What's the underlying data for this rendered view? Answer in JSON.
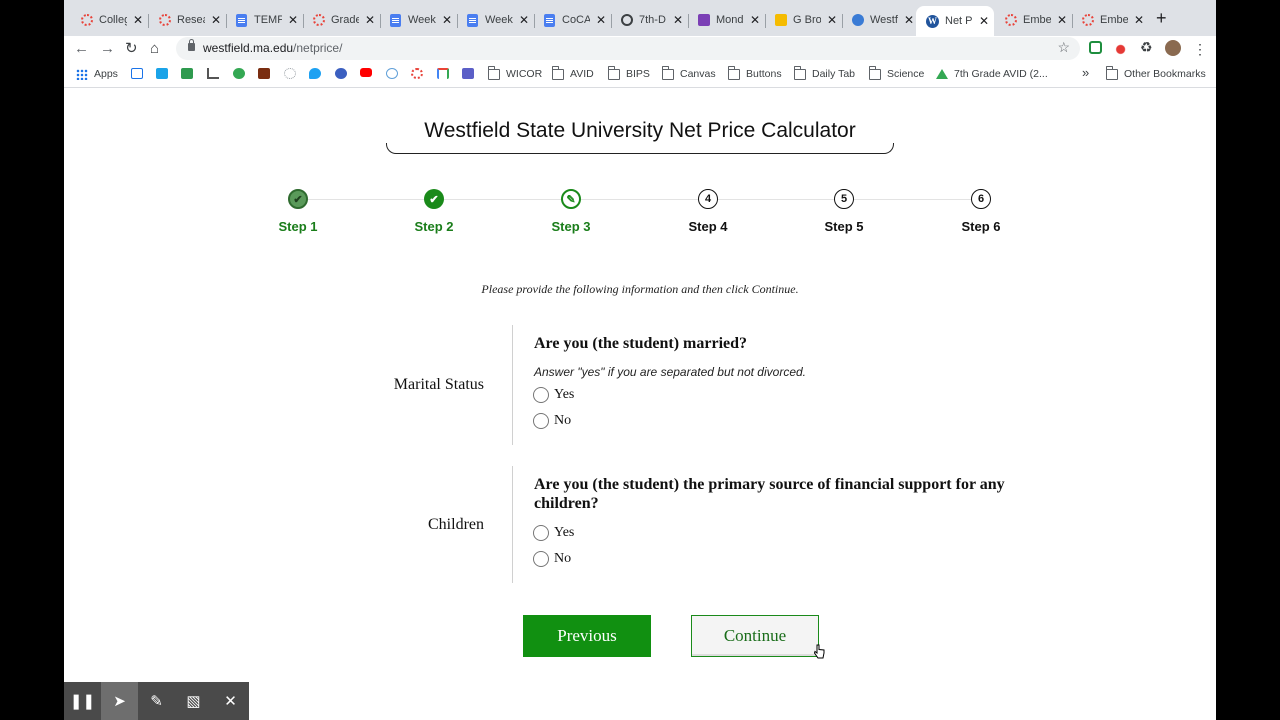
{
  "tabs": [
    {
      "title": "College",
      "favicon": "red-dotted-circle-icon"
    },
    {
      "title": "Research",
      "favicon": "red-dotted-circle-icon"
    },
    {
      "title": "TEMP",
      "favicon": "google-docs-icon"
    },
    {
      "title": "Grade",
      "favicon": "red-dotted-circle-icon"
    },
    {
      "title": "Week",
      "favicon": "google-docs-icon"
    },
    {
      "title": "Week",
      "favicon": "google-docs-icon"
    },
    {
      "title": "CoCA",
      "favicon": "google-docs-icon"
    },
    {
      "title": "7th-D",
      "favicon": "globe-icon"
    },
    {
      "title": "Monday",
      "favicon": "purple-square-icon"
    },
    {
      "title": "G Bro",
      "favicon": "yellow-slides-icon"
    },
    {
      "title": "Westfield",
      "favicon": "blue-chat-icon"
    },
    {
      "title": "Net Price",
      "favicon": "wordpress-icon",
      "active": true
    },
    {
      "title": "Embed",
      "favicon": "red-dotted-circle-icon"
    },
    {
      "title": "Embed",
      "favicon": "red-dotted-circle-icon"
    }
  ],
  "tab_close": "✕",
  "new_tab": "+",
  "address": {
    "host": "westfield.ma.edu",
    "path": "/netprice/"
  },
  "bookmarks": [
    {
      "label": "Apps",
      "icon": "apps-grid-icon"
    },
    {
      "label": "",
      "icon": "calendar-icon"
    },
    {
      "label": "",
      "icon": "blue-square-icon"
    },
    {
      "label": "",
      "icon": "green-drive-icon"
    },
    {
      "label": "",
      "icon": "chart-icon"
    },
    {
      "label": "",
      "icon": "green-plus-icon"
    },
    {
      "label": "",
      "icon": "brown-square-icon"
    },
    {
      "label": "",
      "icon": "spinner-icon"
    },
    {
      "label": "",
      "icon": "twitter-icon"
    },
    {
      "label": "",
      "icon": "blue-badge-icon"
    },
    {
      "label": "",
      "icon": "youtube-icon"
    },
    {
      "label": "",
      "icon": "react-icon"
    },
    {
      "label": "",
      "icon": "red-circle-icon"
    },
    {
      "label": "",
      "icon": "gmail-icon"
    },
    {
      "label": "",
      "icon": "forms-icon"
    },
    {
      "label": "WICOR",
      "icon": "folder-icon"
    },
    {
      "label": "AVID",
      "icon": "folder-icon"
    },
    {
      "label": "BIPS",
      "icon": "folder-icon"
    },
    {
      "label": "Canvas",
      "icon": "folder-icon"
    },
    {
      "label": "Buttons",
      "icon": "folder-icon"
    },
    {
      "label": "Daily Tab",
      "icon": "folder-icon"
    },
    {
      "label": "Science",
      "icon": "folder-icon"
    },
    {
      "label": "7th Grade AVID (2...",
      "icon": "google-drive-icon"
    }
  ],
  "bookmarks_more": "»",
  "other_bookmarks": "Other Bookmarks",
  "page": {
    "title": "Westfield State University Net Price Calculator",
    "steps": [
      {
        "label": "Step 1",
        "marker": "✔",
        "state": "done"
      },
      {
        "label": "Step 2",
        "marker": "✔",
        "state": "done"
      },
      {
        "label": "Step 3",
        "marker": "✎",
        "state": "current"
      },
      {
        "label": "Step 4",
        "marker": "4",
        "state": "todo"
      },
      {
        "label": "Step 5",
        "marker": "5",
        "state": "todo"
      },
      {
        "label": "Step 6",
        "marker": "6",
        "state": "todo"
      }
    ],
    "instructions": "Please provide the following information and then click Continue.",
    "questions": [
      {
        "label": "Marital Status",
        "question": "Are you (the student) married?",
        "hint": "Answer \"yes\" if you are separated but not divorced.",
        "options": [
          "Yes",
          "No"
        ]
      },
      {
        "label": "Children",
        "question": "Are you (the student) the primary source of financial support for any children?",
        "hint": "",
        "options": [
          "Yes",
          "No"
        ]
      }
    ],
    "previous_label": "Previous",
    "continue_label": "Continue"
  },
  "colors": {
    "accent_green": "#119011",
    "step_green": "#1a7d1a",
    "tab_strip": "#dee1e6"
  }
}
